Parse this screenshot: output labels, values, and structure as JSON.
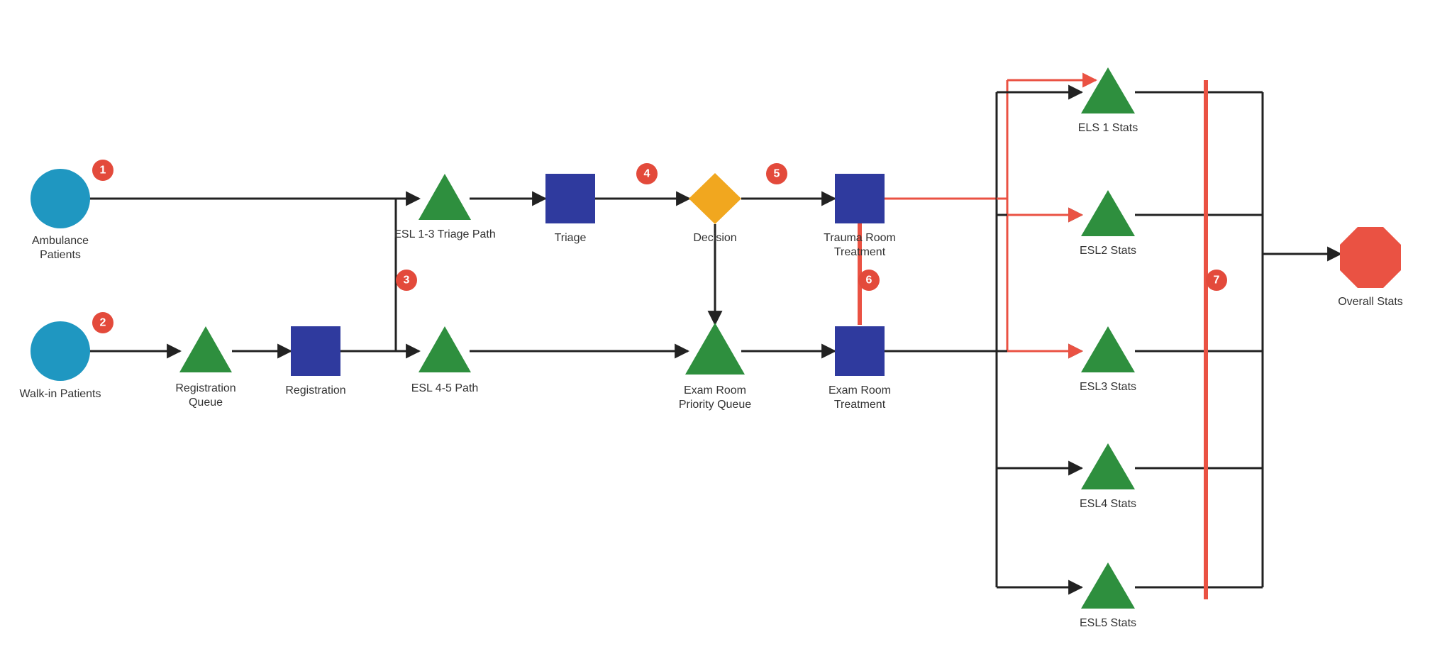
{
  "colors": {
    "circle": "#1f97c1",
    "triangle": "#2e8f3e",
    "square": "#2f3a9e",
    "diamond": "#f1a71f",
    "octagon": "#ea5243",
    "badge": "#e34a3b",
    "line": "#222222",
    "lineRed": "#ea5243"
  },
  "nodes": {
    "ambulance": {
      "label1": "Ambulance",
      "label2": "Patients"
    },
    "walkin": {
      "label1": "Walk-in Patients"
    },
    "regQueue": {
      "label1": "Registration",
      "label2": "Queue"
    },
    "registration": {
      "label1": "Registration"
    },
    "esl13": {
      "label1": "ESL 1-3 Triage Path"
    },
    "esl45": {
      "label1": "ESL 4-5 Path"
    },
    "triage": {
      "label1": "Triage"
    },
    "decision": {
      "label1": "Decision"
    },
    "trauma": {
      "label1": "Trauma Room",
      "label2": "Treatment"
    },
    "examQueue": {
      "label1": "Exam Room",
      "label2": "Priority Queue"
    },
    "examTreat": {
      "label1": "Exam Room",
      "label2": "Treatment"
    },
    "els1": {
      "label1": "ELS 1 Stats"
    },
    "esl2": {
      "label1": "ESL2 Stats"
    },
    "esl3": {
      "label1": "ESL3 Stats"
    },
    "esl4": {
      "label1": "ESL4 Stats"
    },
    "esl5": {
      "label1": "ESL5 Stats"
    },
    "overall": {
      "label1": "Overall Stats"
    }
  },
  "badges": {
    "b1": "1",
    "b2": "2",
    "b3": "3",
    "b4": "4",
    "b5": "5",
    "b6": "6",
    "b7": "7"
  }
}
